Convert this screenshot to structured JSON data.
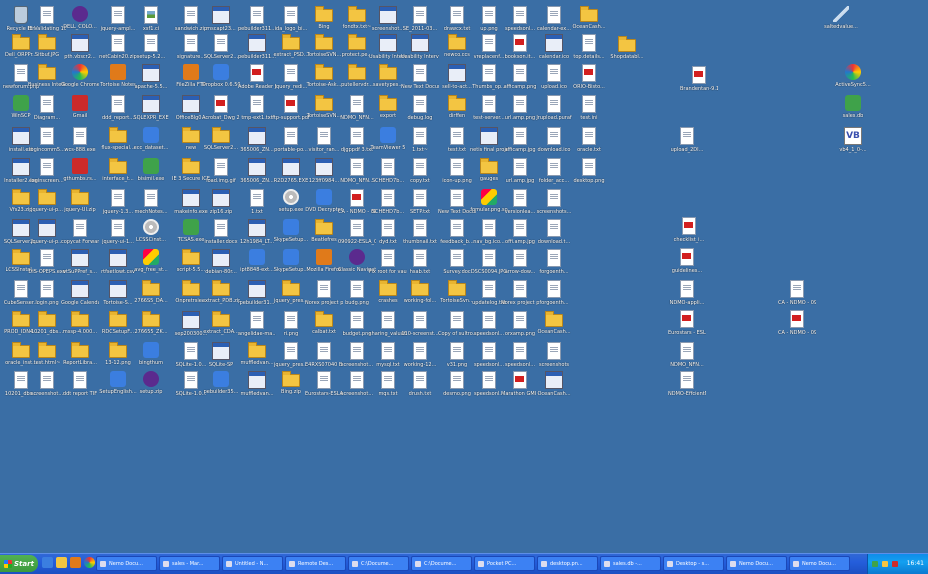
{
  "desktop_columns": [
    [
      {
        "label": "Recycle Bin",
        "icon": "recycle"
      },
      {
        "label": "Dell_ORPPr...",
        "icon": "folder"
      },
      {
        "label": "newforum.php",
        "icon": "doc"
      },
      {
        "label": "WinSCP",
        "icon": "green"
      },
      {
        "label": "install.ext",
        "icon": "exe"
      },
      {
        "label": "Installer2.exe",
        "icon": "exe"
      },
      {
        "label": "Vfs23.zip",
        "icon": "folder"
      },
      {
        "label": "SQLServer2...",
        "icon": "exe"
      },
      {
        "label": "LCSSInstal...",
        "icon": "folder"
      },
      {
        "label": "CubeSenser...",
        "icon": "doc"
      },
      {
        "label": "PROD_IDN4...",
        "icon": "folder"
      },
      {
        "label": "oracle_inst...",
        "icon": "folder"
      },
      {
        "label": "10201_dbs...",
        "icon": "doc"
      }
    ],
    [
      {
        "label": "IE Validating 10016.doc",
        "icon": "doc"
      },
      {
        "label": "Sitbuf.JPG",
        "icon": "folder"
      },
      {
        "label": "Business Intelligence.zip",
        "icon": "folder"
      },
      {
        "label": "Diagram...",
        "icon": "doc"
      },
      {
        "label": "logincomm5...",
        "icon": "doc"
      },
      {
        "label": "loginscreen...",
        "icon": "doc"
      },
      {
        "label": "jquery-ui-p...",
        "icon": "folder"
      },
      {
        "label": "jquery-ui-p...",
        "icon": "exe"
      },
      {
        "label": "DIS-OPEPS.exe",
        "icon": "doc"
      },
      {
        "label": "login.png",
        "icon": "doc"
      },
      {
        "label": "10201_dbs...",
        "icon": "folder"
      },
      {
        "label": "test.html~",
        "icon": "folder"
      },
      {
        "label": "screenshot...",
        "icon": "doc"
      }
    ],
    [
      {
        "label": "DELL_COLO...",
        "icon": "purple"
      },
      {
        "label": "pth.vbscr2...",
        "icon": "exe"
      },
      {
        "label": "Google Chrome",
        "icon": "rb"
      },
      {
        "label": "Gmail",
        "icon": "red"
      },
      {
        "label": "wcs-888.exe",
        "icon": "doc"
      },
      {
        "label": "gthumbs.rs...",
        "icon": "red"
      },
      {
        "label": "jquery-UI.zip",
        "icon": "folder"
      },
      {
        "label": "copycat ForwardAt...",
        "icon": "doc"
      },
      {
        "label": "vtSuPPref_s...",
        "icon": "exe"
      },
      {
        "label": "Google Calendar",
        "icon": "exe"
      },
      {
        "label": "mssp-4.000...",
        "icon": "folder"
      },
      {
        "label": "ReportLibra...",
        "icon": "folder"
      },
      {
        "label": "ddt report TIF",
        "icon": "doc"
      }
    ],
    [
      {
        "label": "jquery-ampl...",
        "icon": "doc"
      },
      {
        "label": "netCabin20.zip",
        "icon": "doc"
      },
      {
        "label": "Tortoise Notes",
        "icon": "orange"
      },
      {
        "label": "ddd_report...",
        "icon": "doc"
      },
      {
        "label": "flux-special...",
        "icon": "folder"
      },
      {
        "label": "interface_t...",
        "icon": "folder"
      },
      {
        "label": "jquery-1.3...",
        "icon": "doc"
      },
      {
        "label": "jquery-ui-1...",
        "icon": "doc"
      },
      {
        "label": "rtfsetlowt.csv",
        "icon": "exe"
      },
      {
        "label": "Tortoise-S...",
        "icon": "exe"
      },
      {
        "label": "RDCSetupF...",
        "icon": "folder"
      },
      {
        "label": "13-12.png",
        "icon": "folder"
      },
      {
        "label": "SetupEnglish...",
        "icon": "blue"
      }
    ],
    [
      {
        "label": "xsf1.ci",
        "icon": "img"
      },
      {
        "label": "setup-5.2...",
        "icon": "doc"
      },
      {
        "label": "apache-5.5...",
        "icon": "exe"
      },
      {
        "label": "SQLEXPR_EXE",
        "icon": "exe"
      },
      {
        "label": "ecc_dataset...",
        "icon": "blue"
      },
      {
        "label": "bisimil.exe",
        "icon": "green"
      },
      {
        "label": "mechNotes...",
        "icon": "doc"
      },
      {
        "label": "LCSSCinst...",
        "icon": "cd"
      },
      {
        "label": "avg_free_st...",
        "icon": "app"
      },
      {
        "label": "2766S5_DA...",
        "icon": "folder"
      },
      {
        "label": "276655_ZK...",
        "icon": "folder"
      },
      {
        "label": "bingthum",
        "icon": "blue"
      },
      {
        "label": "setup.zip",
        "icon": "purple"
      }
    ],
    [
      {
        "label": "sandwich.zip",
        "icon": "doc"
      },
      {
        "label": "signature...",
        "icon": "doc"
      },
      {
        "label": "FileZilla FTP",
        "icon": "orange"
      },
      {
        "label": "OfficeBlg0...",
        "icon": "exe"
      },
      {
        "label": "new",
        "icon": "folder"
      },
      {
        "label": "IE 3 Secure ICE",
        "icon": "folder"
      },
      {
        "label": "makeinfo.exe",
        "icon": "exe"
      },
      {
        "label": "TCSAS.exe",
        "icon": "green"
      },
      {
        "label": "script-5.5...",
        "icon": "folder"
      },
      {
        "label": "Onpretrsie...",
        "icon": "folder"
      },
      {
        "label": "sep200300...",
        "icon": "exe"
      },
      {
        "label": "SQLite-1.0...",
        "icon": "doc"
      },
      {
        "label": "SQLite-1.0...",
        "icon": "doc"
      }
    ],
    [
      {
        "label": "mscapt23...",
        "icon": "exe"
      },
      {
        "label": "SQLServer2...",
        "icon": "doc"
      },
      {
        "label": "Dropbox 0.6.507.exe",
        "icon": "blue"
      },
      {
        "label": "Acrobat_Dwg 2000 Power...",
        "icon": "pdf"
      },
      {
        "label": "SQLServer2...",
        "icon": "folder"
      },
      {
        "label": "load.img.gif",
        "icon": "doc"
      },
      {
        "label": "zip16.zip",
        "icon": "exe"
      },
      {
        "label": "installer.docx",
        "icon": "doc"
      },
      {
        "label": "debian-80r...",
        "icon": "exe"
      },
      {
        "label": "extract_PDB.zip",
        "icon": "folder"
      },
      {
        "label": "extract_CDA...",
        "icon": "folder"
      },
      {
        "label": "SQLite-SP",
        "icon": "exe"
      },
      {
        "label": "pebuilder35...",
        "icon": "blue"
      }
    ],
    [
      {
        "label": "pebuilder311...",
        "icon": "doc"
      },
      {
        "label": "pebuilder311...",
        "icon": "exe"
      },
      {
        "label": "Adobe Reader 8.1.0.exe",
        "icon": "pdf"
      },
      {
        "label": "tmp-ext1.txt",
        "icon": "doc"
      },
      {
        "label": "365006_ZN...",
        "icon": "exe"
      },
      {
        "label": "365006_ZN...",
        "icon": "exe"
      },
      {
        "label": "1.txt",
        "icon": "doc"
      },
      {
        "label": "12h1984_LT...",
        "icon": "exe"
      },
      {
        "label": "ipt8848-ext...",
        "icon": "blue"
      },
      {
        "label": "pebuilder31...",
        "icon": "exe"
      },
      {
        "label": "angelidae-ma...",
        "icon": "doc"
      },
      {
        "label": "muffledvan...",
        "icon": "folder"
      },
      {
        "label": "muffledvan...",
        "icon": "exe"
      }
    ],
    [
      {
        "label": "ida_logo_bi...",
        "icon": "doc"
      },
      {
        "label": "extract_PSD...",
        "icon": "folder"
      },
      {
        "label": "jquery_redi...",
        "icon": "doc"
      },
      {
        "label": "ftp-support.pdf",
        "icon": "pdf"
      },
      {
        "label": "portable-po...",
        "icon": "doc"
      },
      {
        "label": "R2D2765.EXE",
        "icon": "exe"
      },
      {
        "label": "setup.exe",
        "icon": "cd"
      },
      {
        "label": "SkypeSetup...",
        "icon": "blue"
      },
      {
        "label": "SkypeSetup...",
        "icon": "blue"
      },
      {
        "label": "jquery_pres...",
        "icon": "folder"
      },
      {
        "label": "ri.png",
        "icon": "doc"
      },
      {
        "label": "jquery_pres...",
        "icon": "doc"
      },
      {
        "label": "Bing.zip",
        "icon": "folder"
      }
    ],
    [
      {
        "label": "Bing",
        "icon": "folder"
      },
      {
        "label": "TortoiseSVN...",
        "icon": "folder"
      },
      {
        "label": "Tortoise-Ask...",
        "icon": "folder"
      },
      {
        "label": "TortoiseSVN...",
        "icon": "folder"
      },
      {
        "label": "visitor_ran...",
        "icon": "doc"
      },
      {
        "label": "123ff0984...",
        "icon": "exe"
      },
      {
        "label": "DVD Decrypter",
        "icon": "blue"
      },
      {
        "label": "Beatlefres",
        "icon": "folder"
      },
      {
        "label": "Mozilla Firefox",
        "icon": "orange"
      },
      {
        "label": "Norex project plan.txt",
        "icon": "doc"
      },
      {
        "label": "calbat.txt",
        "icon": "folder"
      },
      {
        "label": "E4RXS07040 BudgetFormat...",
        "icon": "doc"
      },
      {
        "label": "Eurostars-ESLA.08B...",
        "icon": "doc"
      }
    ],
    [
      {
        "label": "fondtx.txt~",
        "icon": "folder"
      },
      {
        "label": "protect.pe...",
        "icon": "folder"
      },
      {
        "label": "putellervdr...",
        "icon": "folder"
      },
      {
        "label": "NDMO_NFN...",
        "icon": "doc"
      },
      {
        "label": "djgppdf 3.txt",
        "icon": "doc"
      },
      {
        "label": "NDMO_NFN...",
        "icon": "doc"
      },
      {
        "label": "CA - NDMO - 090922.pdf",
        "icon": "pdf"
      },
      {
        "label": "090922-ESLA_08M...",
        "icon": "doc"
      },
      {
        "label": "Classic Navigator",
        "icon": "purple"
      },
      {
        "label": "budg.png",
        "icon": "doc"
      },
      {
        "label": "budget.png",
        "icon": "doc"
      },
      {
        "label": "screenshot...",
        "icon": "doc"
      },
      {
        "label": "screenshot...",
        "icon": "doc"
      }
    ],
    [
      {
        "label": "screenshot...",
        "icon": "exe"
      },
      {
        "label": "Usability Interviews...",
        "icon": "exe"
      },
      {
        "label": "savetypes...",
        "icon": "folder"
      },
      {
        "label": "export",
        "icon": "folder"
      },
      {
        "label": "TeamViewer 5",
        "icon": "blue"
      },
      {
        "label": "SCHEHD7b...",
        "icon": "doc"
      },
      {
        "label": "SCHEHD7b...",
        "icon": "doc"
      },
      {
        "label": "dyd.txt",
        "icon": "doc"
      },
      {
        "label": "Fix root for vauxt. csv",
        "icon": "doc"
      },
      {
        "label": "crashes",
        "icon": "folder"
      },
      {
        "label": "sharing_valuation...",
        "icon": "doc"
      },
      {
        "label": "mysql.txt",
        "icon": "doc"
      },
      {
        "label": "mqs.txt",
        "icon": "doc"
      }
    ],
    [
      {
        "label": "SE_2011-03...",
        "icon": "doc"
      },
      {
        "label": "Usability Interviews...",
        "icon": "exe"
      },
      {
        "label": "New Text Document...",
        "icon": "doc"
      },
      {
        "label": "debug.log",
        "icon": "doc"
      },
      {
        "label": "1.txt~",
        "icon": "doc"
      },
      {
        "label": "copy.txt",
        "icon": "doc"
      },
      {
        "label": "SETP.txt",
        "icon": "doc"
      },
      {
        "label": "thumbnail.txt",
        "icon": "doc"
      },
      {
        "label": "hsab.txt",
        "icon": "doc"
      },
      {
        "label": "working-fol...",
        "icon": "folder"
      },
      {
        "label": "110-screenst...",
        "icon": "doc"
      },
      {
        "label": "working-12...",
        "icon": "doc"
      },
      {
        "label": "drush.txt",
        "icon": "doc"
      }
    ],
    [
      {
        "label": "drawcx.txt",
        "icon": "doc"
      },
      {
        "label": "newco.ccs",
        "icon": "folder"
      },
      {
        "label": "sell-to-act...",
        "icon": "exe"
      },
      {
        "label": "dirffen",
        "icon": "folder"
      },
      {
        "label": "test.txt",
        "icon": "doc"
      },
      {
        "label": "icon-up.png",
        "icon": "doc"
      },
      {
        "label": "New Text Document.txt",
        "icon": "doc"
      },
      {
        "label": "feedback_b...",
        "icon": "doc"
      },
      {
        "label": "Survey.doc",
        "icon": "doc"
      },
      {
        "label": "TortoiseSvn...",
        "icon": "folder"
      },
      {
        "label": "Copy of sultro.db",
        "icon": "doc"
      },
      {
        "label": "v31.png",
        "icon": "doc"
      },
      {
        "label": "desmo.png",
        "icon": "doc"
      }
    ],
    [
      {
        "label": "up.png",
        "icon": "doc"
      },
      {
        "label": "vreplacenf...",
        "icon": "doc"
      },
      {
        "label": "Thumbs_op...",
        "icon": "doc"
      },
      {
        "label": "test-server...",
        "icon": "doc"
      },
      {
        "label": "netis final project",
        "icon": "exe"
      },
      {
        "label": "gauges",
        "icon": "folder"
      },
      {
        "label": "fomular.png.so",
        "icon": "app"
      },
      {
        "label": "nav_bg.ico...",
        "icon": "doc"
      },
      {
        "label": "DSCS0094.JPG",
        "icon": "doc"
      },
      {
        "label": "updatelog.txt",
        "icon": "doc"
      },
      {
        "label": "speedsonl...",
        "icon": "doc"
      },
      {
        "label": "speedsonl...",
        "icon": "doc"
      },
      {
        "label": "speedsonl...",
        "icon": "doc"
      }
    ],
    [
      {
        "label": "speedsonl...",
        "icon": "doc"
      },
      {
        "label": "bookson.it...",
        "icon": "pdf"
      },
      {
        "label": "afficamp.png",
        "icon": "doc"
      },
      {
        "label": "url.amp.png",
        "icon": "doc"
      },
      {
        "label": "afficamp.jpg",
        "icon": "doc"
      },
      {
        "label": "url.amp.jpg",
        "icon": "doc"
      },
      {
        "label": "versionlea...",
        "icon": "doc"
      },
      {
        "label": "offi.amp.jpg",
        "icon": "doc"
      },
      {
        "label": "arrow-dow...",
        "icon": "doc"
      },
      {
        "label": "Norex project plan.txt",
        "icon": "doc"
      },
      {
        "label": "orxamp.png",
        "icon": "doc"
      },
      {
        "label": "speedsonl...",
        "icon": "doc"
      },
      {
        "label": "Marathon GMI - Internati...",
        "icon": "pdf"
      }
    ],
    [
      {
        "label": "calendar-ex...",
        "icon": "doc"
      },
      {
        "label": "calendar.ico",
        "icon": "exe"
      },
      {
        "label": "upload.ico",
        "icon": "doc"
      },
      {
        "label": "Jrupload.puraf",
        "icon": "doc"
      },
      {
        "label": "download.ico",
        "icon": "doc"
      },
      {
        "label": "folder_acc...",
        "icon": "doc"
      },
      {
        "label": "screenshots...",
        "icon": "doc"
      },
      {
        "label": "download.t...",
        "icon": "doc"
      },
      {
        "label": "forgoenth...",
        "icon": "doc"
      },
      {
        "label": "forgoenth...",
        "icon": "doc"
      },
      {
        "label": "OceanCash...",
        "icon": "folder"
      },
      {
        "label": "screenshots",
        "icon": "doc"
      },
      {
        "label": "OceanCash...",
        "icon": "exe"
      }
    ],
    [
      {
        "label": "OceanCash...",
        "icon": "folder"
      },
      {
        "label": "top.details...",
        "icon": "doc"
      },
      {
        "label": "ORIO-Bisto...",
        "icon": "pdf"
      },
      {
        "label": "test.ini",
        "icon": "doc"
      },
      {
        "label": "oracle.txt",
        "icon": "doc"
      },
      {
        "label": "desktop.png",
        "icon": "doc"
      }
    ]
  ],
  "extra_icons": [
    {
      "label": "Shopdatabl...",
      "icon": "folder"
    },
    {
      "label": "Brandentan-9.11.pdf",
      "icon": "pdf"
    },
    {
      "label": "upload_2DI...",
      "icon": "doc"
    },
    {
      "label": "checklist_i...",
      "icon": "pdf"
    },
    {
      "label": "guidelines...",
      "icon": "pdf"
    },
    {
      "label": "NDMO-appli...",
      "icon": "doc"
    },
    {
      "label": "Eurostars - ESLA-09...",
      "icon": "pdf"
    },
    {
      "label": "NDMO_NFN...",
      "icon": "doc"
    },
    {
      "label": "NDMO-EffcientMaxis...",
      "icon": "doc"
    },
    {
      "label": "CA - NDMO - 090922 docx",
      "icon": "doc"
    },
    {
      "label": "CA - NDMO - 090922-1.pdf",
      "icon": "pdf"
    },
    {
      "label": "saltedvalue...",
      "icon": "pen"
    },
    {
      "label": "ActiveSync5...",
      "icon": "rb"
    },
    {
      "label": "sales.db",
      "icon": "green"
    },
    {
      "label": "vb4_1_0-...",
      "icon": "vb"
    }
  ],
  "taskbar": {
    "start_label": "Start",
    "buttons": [
      "Nemo Docu...",
      "sales - Mar...",
      "Untitled - N...",
      "Remote Des...",
      "C:\\Docume...",
      "C:\\Docume...",
      "Pocket PC...",
      "desktop.pn...",
      "sales.db -...",
      "Desktop - s...",
      "Nemo Docu...",
      "Nemo Docu..."
    ],
    "clock": "16:41"
  }
}
